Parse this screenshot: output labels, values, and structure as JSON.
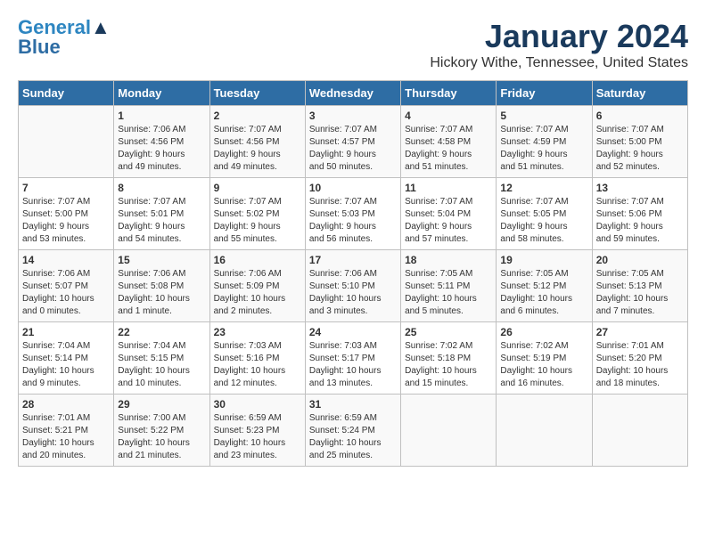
{
  "header": {
    "logo_line1": "General",
    "logo_line2": "Blue",
    "month": "January 2024",
    "location": "Hickory Withe, Tennessee, United States"
  },
  "days_of_week": [
    "Sunday",
    "Monday",
    "Tuesday",
    "Wednesday",
    "Thursday",
    "Friday",
    "Saturday"
  ],
  "weeks": [
    [
      {
        "day": "",
        "info": ""
      },
      {
        "day": "1",
        "info": "Sunrise: 7:06 AM\nSunset: 4:56 PM\nDaylight: 9 hours\nand 49 minutes."
      },
      {
        "day": "2",
        "info": "Sunrise: 7:07 AM\nSunset: 4:56 PM\nDaylight: 9 hours\nand 49 minutes."
      },
      {
        "day": "3",
        "info": "Sunrise: 7:07 AM\nSunset: 4:57 PM\nDaylight: 9 hours\nand 50 minutes."
      },
      {
        "day": "4",
        "info": "Sunrise: 7:07 AM\nSunset: 4:58 PM\nDaylight: 9 hours\nand 51 minutes."
      },
      {
        "day": "5",
        "info": "Sunrise: 7:07 AM\nSunset: 4:59 PM\nDaylight: 9 hours\nand 51 minutes."
      },
      {
        "day": "6",
        "info": "Sunrise: 7:07 AM\nSunset: 5:00 PM\nDaylight: 9 hours\nand 52 minutes."
      }
    ],
    [
      {
        "day": "7",
        "info": "Sunrise: 7:07 AM\nSunset: 5:00 PM\nDaylight: 9 hours\nand 53 minutes."
      },
      {
        "day": "8",
        "info": "Sunrise: 7:07 AM\nSunset: 5:01 PM\nDaylight: 9 hours\nand 54 minutes."
      },
      {
        "day": "9",
        "info": "Sunrise: 7:07 AM\nSunset: 5:02 PM\nDaylight: 9 hours\nand 55 minutes."
      },
      {
        "day": "10",
        "info": "Sunrise: 7:07 AM\nSunset: 5:03 PM\nDaylight: 9 hours\nand 56 minutes."
      },
      {
        "day": "11",
        "info": "Sunrise: 7:07 AM\nSunset: 5:04 PM\nDaylight: 9 hours\nand 57 minutes."
      },
      {
        "day": "12",
        "info": "Sunrise: 7:07 AM\nSunset: 5:05 PM\nDaylight: 9 hours\nand 58 minutes."
      },
      {
        "day": "13",
        "info": "Sunrise: 7:07 AM\nSunset: 5:06 PM\nDaylight: 9 hours\nand 59 minutes."
      }
    ],
    [
      {
        "day": "14",
        "info": "Sunrise: 7:06 AM\nSunset: 5:07 PM\nDaylight: 10 hours\nand 0 minutes."
      },
      {
        "day": "15",
        "info": "Sunrise: 7:06 AM\nSunset: 5:08 PM\nDaylight: 10 hours\nand 1 minute."
      },
      {
        "day": "16",
        "info": "Sunrise: 7:06 AM\nSunset: 5:09 PM\nDaylight: 10 hours\nand 2 minutes."
      },
      {
        "day": "17",
        "info": "Sunrise: 7:06 AM\nSunset: 5:10 PM\nDaylight: 10 hours\nand 3 minutes."
      },
      {
        "day": "18",
        "info": "Sunrise: 7:05 AM\nSunset: 5:11 PM\nDaylight: 10 hours\nand 5 minutes."
      },
      {
        "day": "19",
        "info": "Sunrise: 7:05 AM\nSunset: 5:12 PM\nDaylight: 10 hours\nand 6 minutes."
      },
      {
        "day": "20",
        "info": "Sunrise: 7:05 AM\nSunset: 5:13 PM\nDaylight: 10 hours\nand 7 minutes."
      }
    ],
    [
      {
        "day": "21",
        "info": "Sunrise: 7:04 AM\nSunset: 5:14 PM\nDaylight: 10 hours\nand 9 minutes."
      },
      {
        "day": "22",
        "info": "Sunrise: 7:04 AM\nSunset: 5:15 PM\nDaylight: 10 hours\nand 10 minutes."
      },
      {
        "day": "23",
        "info": "Sunrise: 7:03 AM\nSunset: 5:16 PM\nDaylight: 10 hours\nand 12 minutes."
      },
      {
        "day": "24",
        "info": "Sunrise: 7:03 AM\nSunset: 5:17 PM\nDaylight: 10 hours\nand 13 minutes."
      },
      {
        "day": "25",
        "info": "Sunrise: 7:02 AM\nSunset: 5:18 PM\nDaylight: 10 hours\nand 15 minutes."
      },
      {
        "day": "26",
        "info": "Sunrise: 7:02 AM\nSunset: 5:19 PM\nDaylight: 10 hours\nand 16 minutes."
      },
      {
        "day": "27",
        "info": "Sunrise: 7:01 AM\nSunset: 5:20 PM\nDaylight: 10 hours\nand 18 minutes."
      }
    ],
    [
      {
        "day": "28",
        "info": "Sunrise: 7:01 AM\nSunset: 5:21 PM\nDaylight: 10 hours\nand 20 minutes."
      },
      {
        "day": "29",
        "info": "Sunrise: 7:00 AM\nSunset: 5:22 PM\nDaylight: 10 hours\nand 21 minutes."
      },
      {
        "day": "30",
        "info": "Sunrise: 6:59 AM\nSunset: 5:23 PM\nDaylight: 10 hours\nand 23 minutes."
      },
      {
        "day": "31",
        "info": "Sunrise: 6:59 AM\nSunset: 5:24 PM\nDaylight: 10 hours\nand 25 minutes."
      },
      {
        "day": "",
        "info": ""
      },
      {
        "day": "",
        "info": ""
      },
      {
        "day": "",
        "info": ""
      }
    ]
  ]
}
